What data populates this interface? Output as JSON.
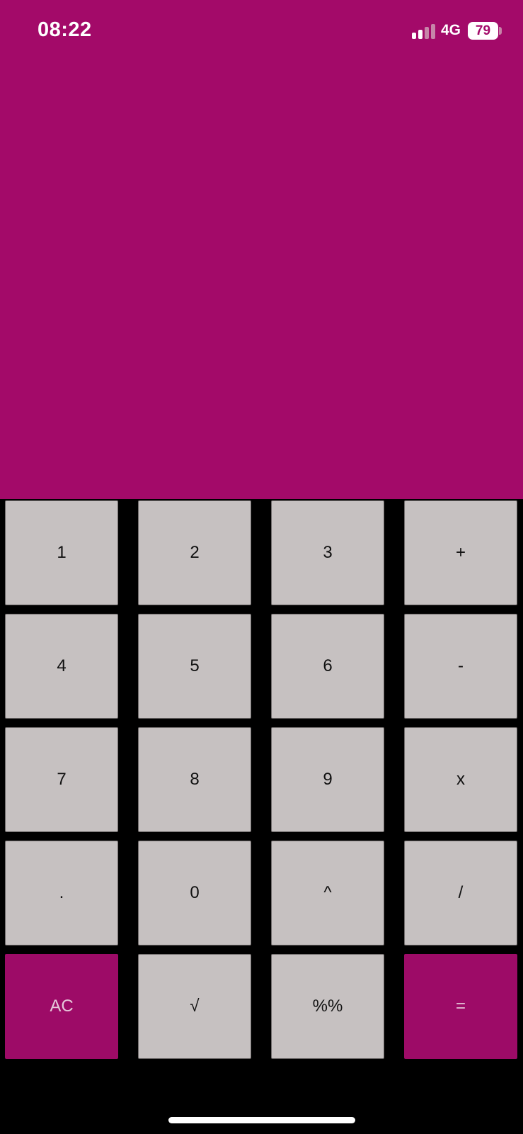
{
  "status_bar": {
    "time": "08:22",
    "network": "4G",
    "battery": "79",
    "signal_bars_active": 2,
    "signal_bars_total": 4
  },
  "display": {
    "value": ""
  },
  "keypad": {
    "rows": [
      [
        {
          "label": "1"
        },
        {
          "label": "2"
        },
        {
          "label": "3"
        },
        {
          "label": "+"
        }
      ],
      [
        {
          "label": "4"
        },
        {
          "label": "5"
        },
        {
          "label": "6"
        },
        {
          "label": "-"
        }
      ],
      [
        {
          "label": "7"
        },
        {
          "label": "8"
        },
        {
          "label": "9"
        },
        {
          "label": "x"
        }
      ],
      [
        {
          "label": "."
        },
        {
          "label": "0"
        },
        {
          "label": "^"
        },
        {
          "label": "/"
        }
      ],
      [
        {
          "label": "AC"
        },
        {
          "label": "√"
        },
        {
          "label": "%%"
        },
        {
          "label": "="
        }
      ]
    ]
  },
  "colors": {
    "accent": "#a30a69",
    "key_background": "#c6c1c1",
    "keypad_background": "#000000"
  }
}
